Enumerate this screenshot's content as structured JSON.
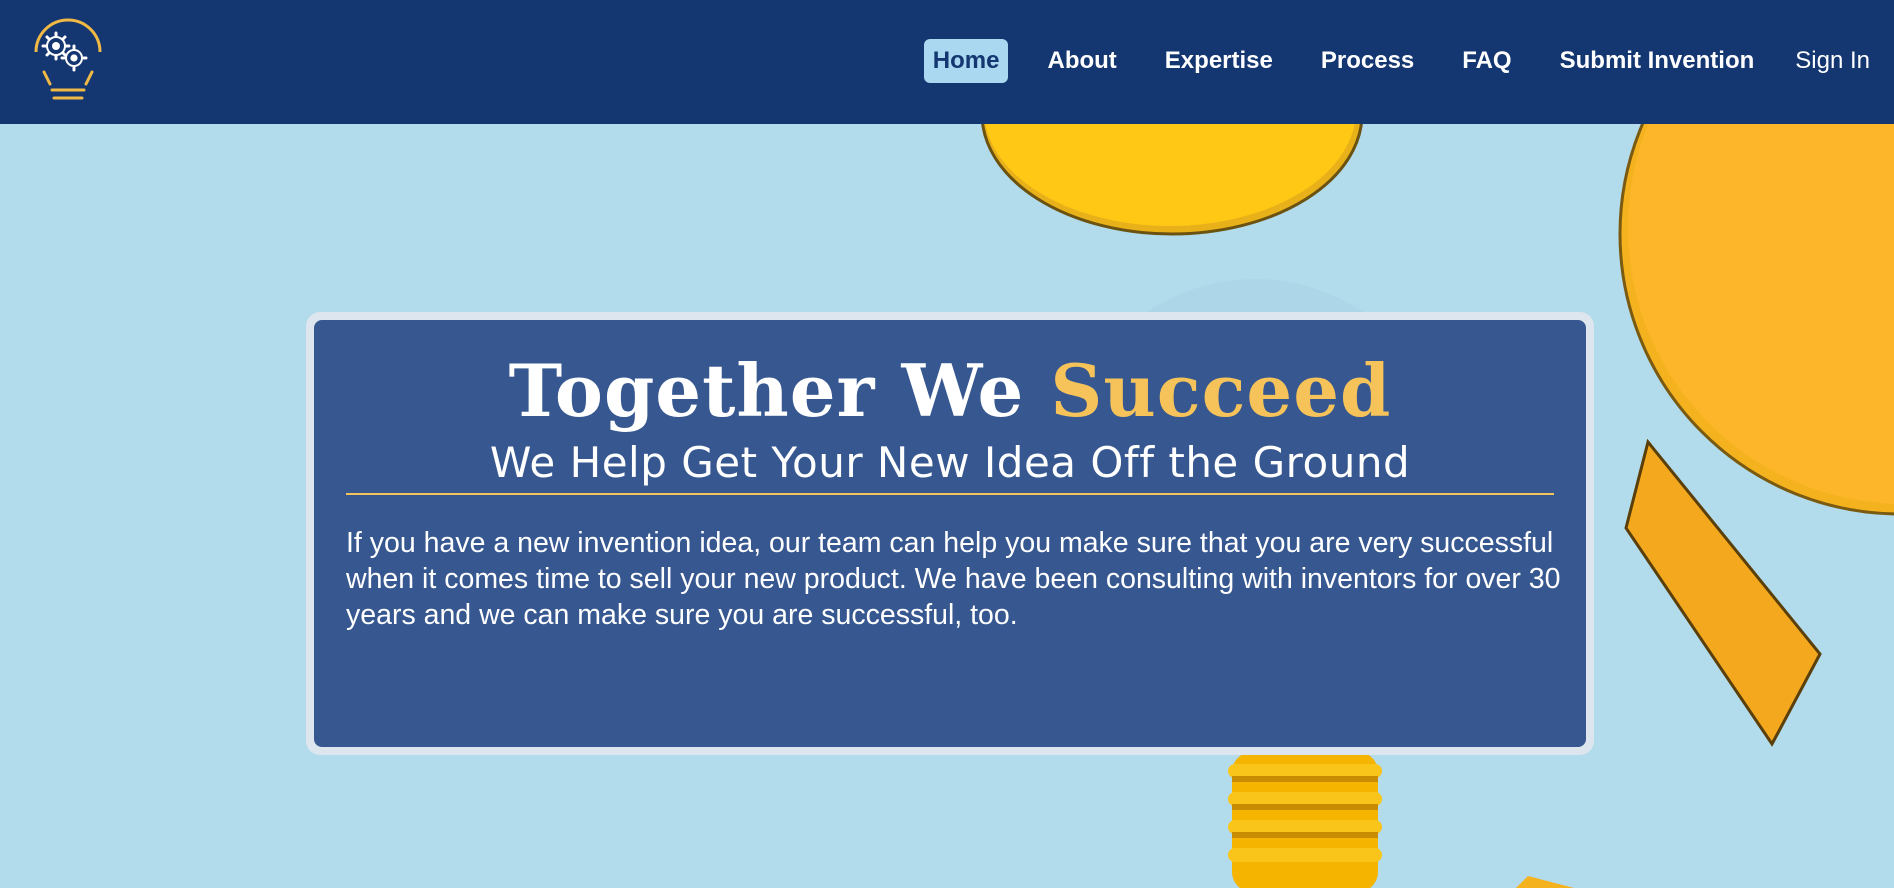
{
  "header": {
    "logo_icon": "lightbulb-gears-icon",
    "nav": [
      {
        "label": "Home",
        "active": true
      },
      {
        "label": "About"
      },
      {
        "label": "Expertise"
      },
      {
        "label": "Process"
      },
      {
        "label": "FAQ"
      },
      {
        "label": "Submit Invention"
      }
    ],
    "sign_in": "Sign In"
  },
  "hero": {
    "headline_main": "Together We ",
    "headline_accent": "Succeed",
    "subheadline": "We Help Get Your New Idea Off the Ground",
    "body": "If you have a new invention idea, our team can help you make sure that you are very successful when it comes time to sell your new product. We have been consulting with inventors for over 30 years and we can make sure you are successful, too."
  },
  "colors": {
    "header_bg": "#143671",
    "accent": "#f5c35a",
    "hero_bg": "#b2dbeb",
    "card_bg": "#163c7d"
  }
}
